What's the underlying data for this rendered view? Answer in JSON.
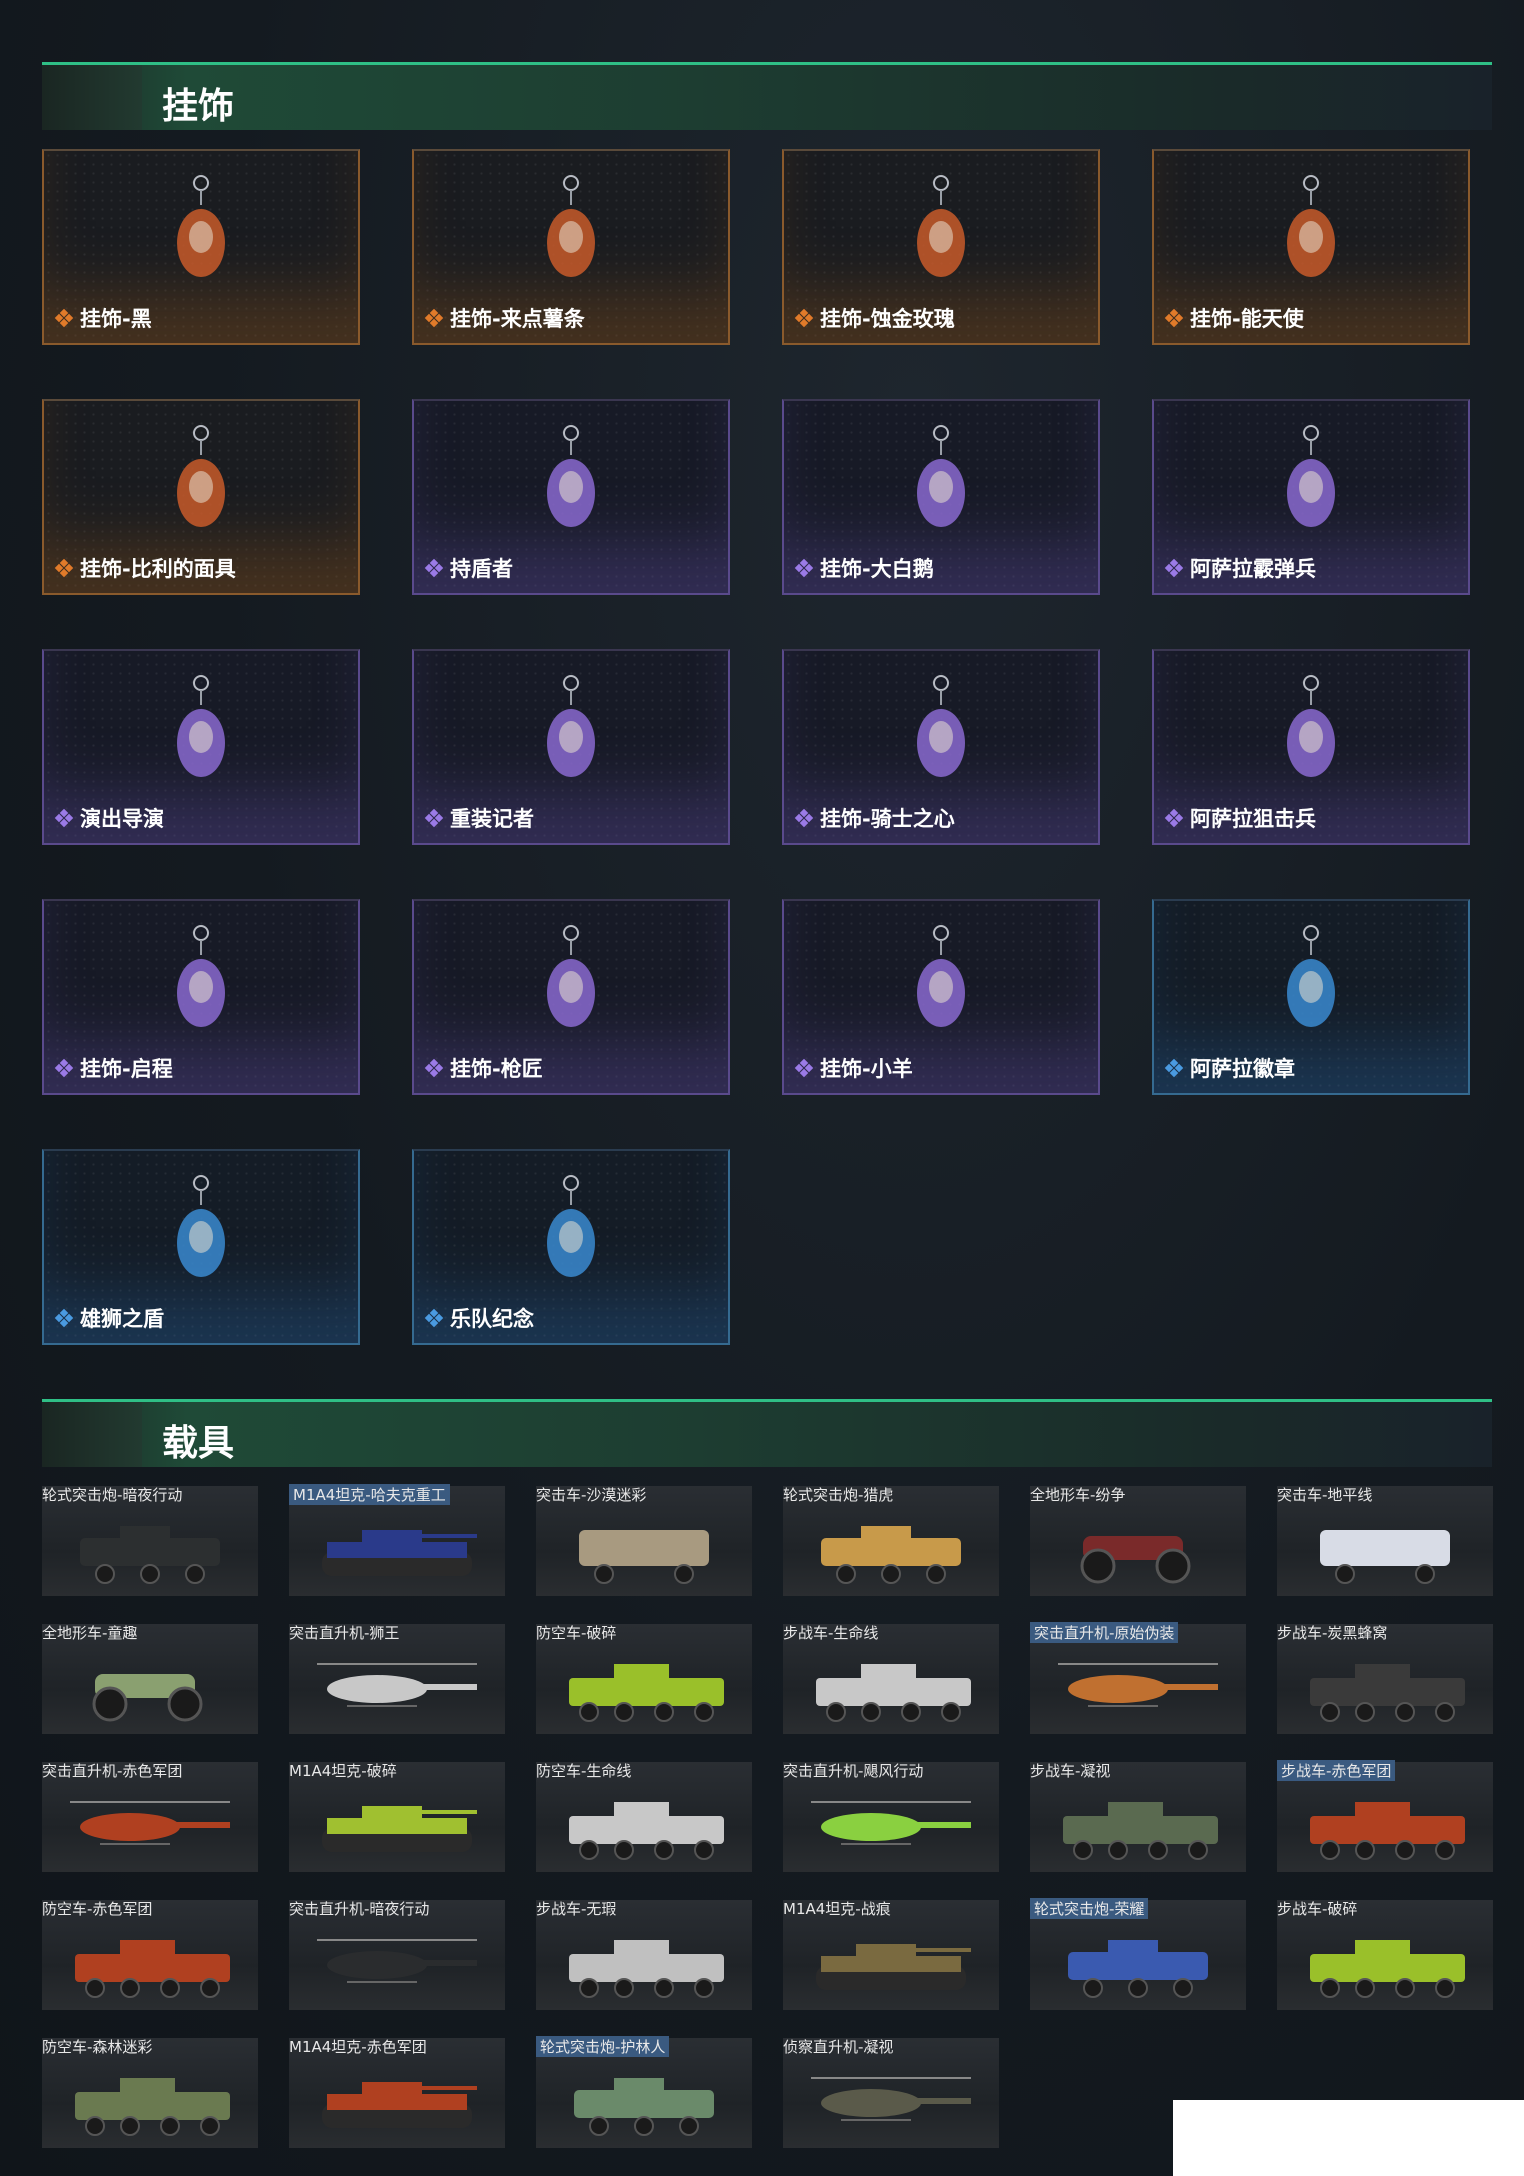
{
  "sections": {
    "pendants_title": "挂饰",
    "vehicles_title": "载具"
  },
  "pendants": [
    {
      "name": "挂饰-黑",
      "rarity": "orange",
      "icon": "tag-pendant-icon"
    },
    {
      "name": "挂饰-来点薯条",
      "rarity": "orange",
      "icon": "fries-pendant-icon"
    },
    {
      "name": "挂饰-蚀金玫瑰",
      "rarity": "orange",
      "icon": "rose-badge-pendant-icon"
    },
    {
      "name": "挂饰-能天使",
      "rarity": "orange",
      "icon": "tag-pendant-icon"
    },
    {
      "name": "挂饰-比利的面具",
      "rarity": "orange",
      "icon": "mask-pendant-icon"
    },
    {
      "name": "持盾者",
      "rarity": "purple",
      "icon": "shield-bearer-figure-icon"
    },
    {
      "name": "挂饰-大白鹅",
      "rarity": "purple",
      "icon": "goose-pendant-icon"
    },
    {
      "name": "阿萨拉霰弹兵",
      "rarity": "purple",
      "icon": "shotgunner-figure-icon"
    },
    {
      "name": "演出导演",
      "rarity": "purple",
      "icon": "director-figure-icon"
    },
    {
      "name": "重装记者",
      "rarity": "purple",
      "icon": "reporter-figure-icon"
    },
    {
      "name": "挂饰-骑士之心",
      "rarity": "purple",
      "icon": "knight-heart-pendant-icon"
    },
    {
      "name": "阿萨拉狙击兵",
      "rarity": "purple",
      "icon": "sniper-figure-icon"
    },
    {
      "name": "挂饰-启程",
      "rarity": "purple",
      "icon": "departure-badge-icon"
    },
    {
      "name": "挂饰-枪匠",
      "rarity": "purple",
      "icon": "gunsmith-pendant-icon"
    },
    {
      "name": "挂饰-小羊",
      "rarity": "purple",
      "icon": "lamb-pendant-icon"
    },
    {
      "name": "阿萨拉徽章",
      "rarity": "blue",
      "icon": "emblem-pendant-icon"
    },
    {
      "name": "雄狮之盾",
      "rarity": "blue",
      "icon": "lion-shield-pendant-icon"
    },
    {
      "name": "乐队纪念",
      "rarity": "blue",
      "icon": "band-badge-pendant-icon"
    }
  ],
  "vehicles": [
    {
      "name": "轮式突击炮-暗夜行动",
      "kind": "wheeled",
      "color": "#2c2f30"
    },
    {
      "name": "M1A4坦克-哈夫克重工",
      "kind": "tank",
      "color": "#2a3a8a",
      "highlight": true
    },
    {
      "name": "突击车-沙漠迷彩",
      "kind": "truck",
      "color": "#a89a80"
    },
    {
      "name": "轮式突击炮-猎虎",
      "kind": "wheeled",
      "color": "#c89a4a"
    },
    {
      "name": "全地形车-纷争",
      "kind": "atv",
      "color": "#7a2a2a"
    },
    {
      "name": "突击车-地平线",
      "kind": "truck",
      "color": "#d8dce6"
    },
    {
      "name": "全地形车-童趣",
      "kind": "atv",
      "color": "#8aa070"
    },
    {
      "name": "突击直升机-狮王",
      "kind": "heli",
      "color": "#c8c8c8"
    },
    {
      "name": "防空车-破碎",
      "kind": "apc",
      "color": "#9ac02a"
    },
    {
      "name": "步战车-生命线",
      "kind": "apc",
      "color": "#c8c8c8"
    },
    {
      "name": "突击直升机-原始伪装",
      "kind": "heli",
      "color": "#c07030",
      "highlight": true
    },
    {
      "name": "步战车-炭黑蜂窝",
      "kind": "apc",
      "color": "#3a3a3a"
    },
    {
      "name": "突击直升机-赤色军团",
      "kind": "heli",
      "color": "#b04020"
    },
    {
      "name": "M1A4坦克-破碎",
      "kind": "tank",
      "color": "#a0c030"
    },
    {
      "name": "防空车-生命线",
      "kind": "apc",
      "color": "#c8c8c8"
    },
    {
      "name": "突击直升机-飓风行动",
      "kind": "heli",
      "color": "#8ad040"
    },
    {
      "name": "步战车-凝视",
      "kind": "apc",
      "color": "#5a6a50"
    },
    {
      "name": "步战车-赤色军团",
      "kind": "apc",
      "color": "#b04020",
      "highlight": true
    },
    {
      "name": "防空车-赤色军团",
      "kind": "apc",
      "color": "#b04020"
    },
    {
      "name": "突击直升机-暗夜行动",
      "kind": "heli",
      "color": "#2a2c2e"
    },
    {
      "name": "步战车-无瑕",
      "kind": "apc",
      "color": "#c0c0c0"
    },
    {
      "name": "M1A4坦克-战痕",
      "kind": "tank",
      "color": "#7a6a40"
    },
    {
      "name": "轮式突击炮-荣耀",
      "kind": "wheeled",
      "color": "#3a5ab0",
      "highlight": true
    },
    {
      "name": "步战车-破碎",
      "kind": "apc",
      "color": "#9ac02a"
    },
    {
      "name": "防空车-森林迷彩",
      "kind": "apc",
      "color": "#6a7a50"
    },
    {
      "name": "M1A4坦克-赤色军团",
      "kind": "tank",
      "color": "#b04020"
    },
    {
      "name": "轮式突击炮-护林人",
      "kind": "wheeled",
      "color": "#6a8a6a",
      "highlight": true
    },
    {
      "name": "侦察直升机-凝视",
      "kind": "heli",
      "color": "#5a5a4a"
    }
  ]
}
